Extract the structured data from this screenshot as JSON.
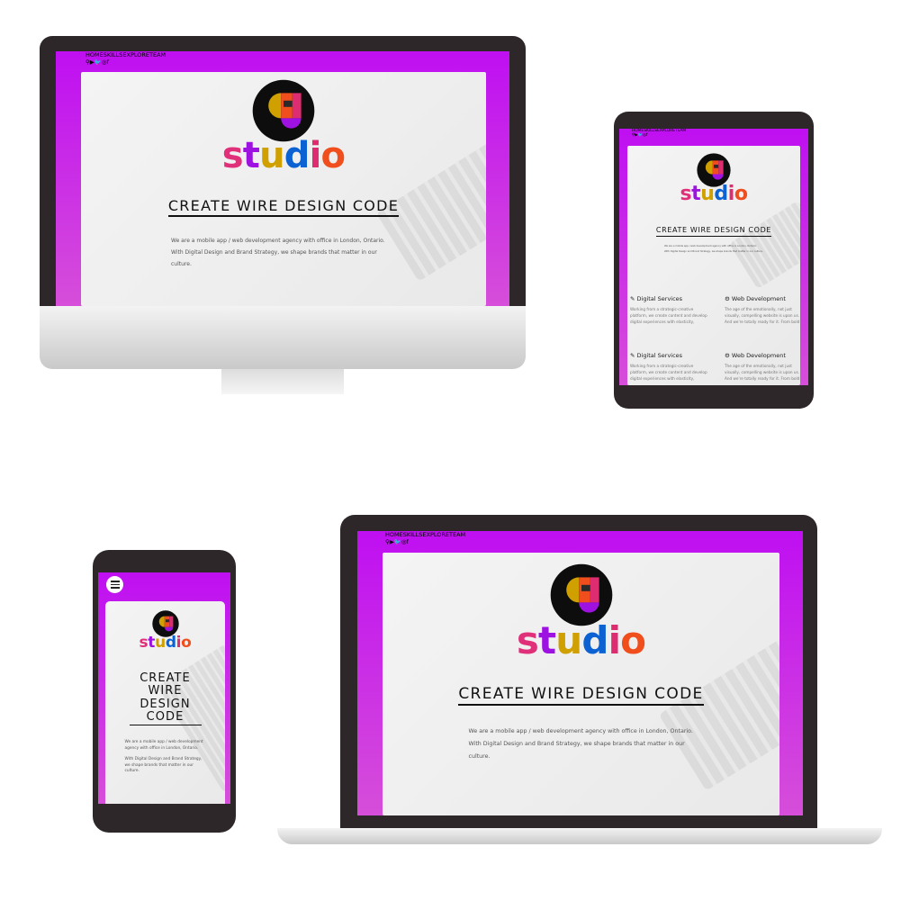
{
  "nav": {
    "items": [
      "HOME",
      "SKILLS",
      "EXPLORE",
      "TEAM"
    ],
    "icons": [
      {
        "name": "search-icon",
        "glyph": "⚲"
      },
      {
        "name": "youtube-icon",
        "glyph": "▶"
      },
      {
        "name": "twitter-icon",
        "glyph": "🐦"
      },
      {
        "name": "instagram-icon",
        "glyph": "◎"
      },
      {
        "name": "facebook-icon",
        "glyph": "f"
      }
    ]
  },
  "hero": {
    "brand": "studio",
    "headline": "CREATE WIRE DESIGN CODE",
    "paragraph_1": "We are a mobile app / web development agency with office in London, Ontario.",
    "paragraph_2": "With Digital Design and Brand Strategy, we shape brands that matter in our culture."
  },
  "services": [
    {
      "icon": "pencil-icon",
      "title": "Digital Services",
      "text": "Working from a strategic-creative platform, we create content and develop digital experiences with elasticity, expanding and contorting"
    },
    {
      "icon": "gear-icon",
      "title": "Web Development",
      "text": "The age of the emotionally, not just visually, compelling website is upon us. And we're totally ready for it. From bold and insightful"
    }
  ],
  "menu_icon": "hamburger-menu-icon",
  "colors": {
    "nav": "#27082f",
    "gradient_top": "#bf0ff2",
    "gradient_bottom": "#d64ed9",
    "frame": "#2e2729"
  }
}
